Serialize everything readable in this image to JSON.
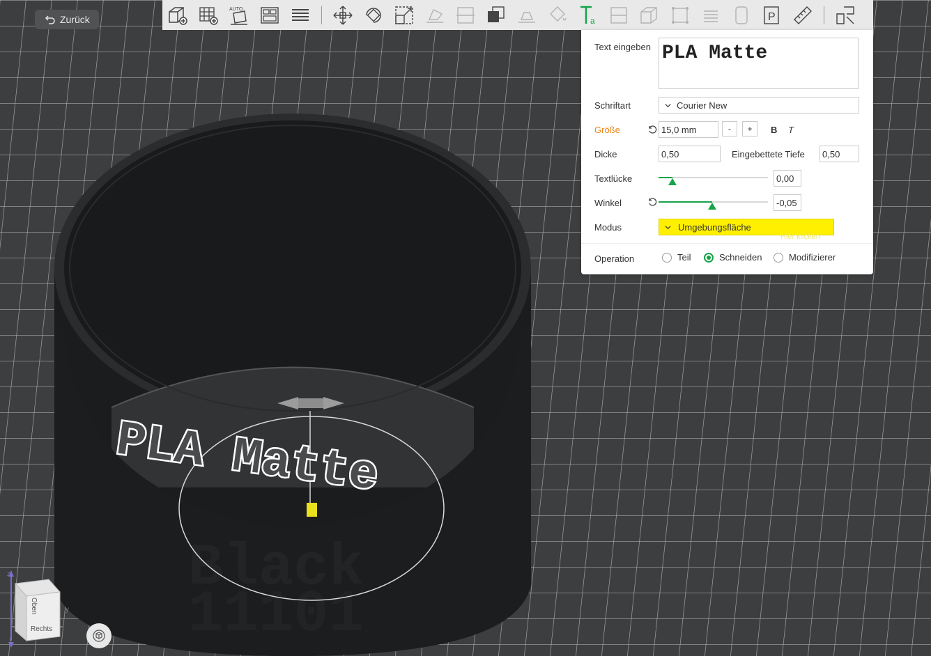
{
  "back": {
    "label": "Zurück"
  },
  "toolbar": {
    "items": [
      {
        "icon": "add-object-icon"
      },
      {
        "icon": "add-plate-icon"
      },
      {
        "icon": "auto-orient-icon"
      },
      {
        "icon": "arrange-icon"
      },
      {
        "icon": "slice-layers-icon"
      },
      {
        "icon": "move-icon"
      },
      {
        "icon": "rotate-icon"
      },
      {
        "icon": "scale-icon"
      },
      {
        "icon": "lay-on-face-icon"
      },
      {
        "icon": "cut-icon"
      },
      {
        "icon": "boolean-icon"
      },
      {
        "icon": "support-paint-icon"
      },
      {
        "icon": "color-paint-icon"
      },
      {
        "icon": "text-icon"
      },
      {
        "icon": "seam-paint-icon"
      },
      {
        "icon": "hollow-icon"
      },
      {
        "icon": "measure-edges-icon"
      },
      {
        "icon": "fdm-supports-icon"
      },
      {
        "icon": "variable-layer-icon"
      },
      {
        "icon": "assembly-view-icon"
      },
      {
        "icon": "measure-ruler-icon"
      },
      {
        "icon": "assembly-icon"
      }
    ]
  },
  "panel": {
    "text_label": "Text eingeben",
    "text_value": "PLA Matte",
    "font_label": "Schriftart",
    "font_value": "Courier New",
    "size_label": "Größe",
    "size_value": "15,0 mm",
    "size_minus": "-",
    "size_plus": "+",
    "bold": "B",
    "italic": "T",
    "thickness_label": "Dicke",
    "thickness_value": "0,50",
    "embedded_label": "Eingebettete Tiefe",
    "embedded_value": "0,50",
    "gap_label": "Textlücke",
    "gap_value": "0,00",
    "gap_level": 0.13,
    "angle_label": "Winkel",
    "angle_value": "-0,05",
    "angle_level": 0.49,
    "mode_label": "Modus",
    "mode_value": "Umgebungsfläche",
    "mode_hint": "Hier klicken",
    "operation_label": "Operation",
    "operations": [
      {
        "label": "Teil",
        "selected": false
      },
      {
        "label": "Schneiden",
        "selected": true
      },
      {
        "label": "Modifizierer",
        "selected": false
      }
    ]
  },
  "scene": {
    "text_on_model": "PLA Matte",
    "engraved_line1": "Black",
    "engraved_line2": "11101"
  },
  "viewcube": {
    "face_top": "Oben",
    "face_right": "Rechts",
    "axis_y": "y",
    "axis_z": "z"
  },
  "colors": {
    "accent": "#16a34a",
    "mode_highlight": "#fff000",
    "size_label": "#e9871c",
    "bed": "#3d3e3f",
    "model": "#1b1c1d"
  }
}
